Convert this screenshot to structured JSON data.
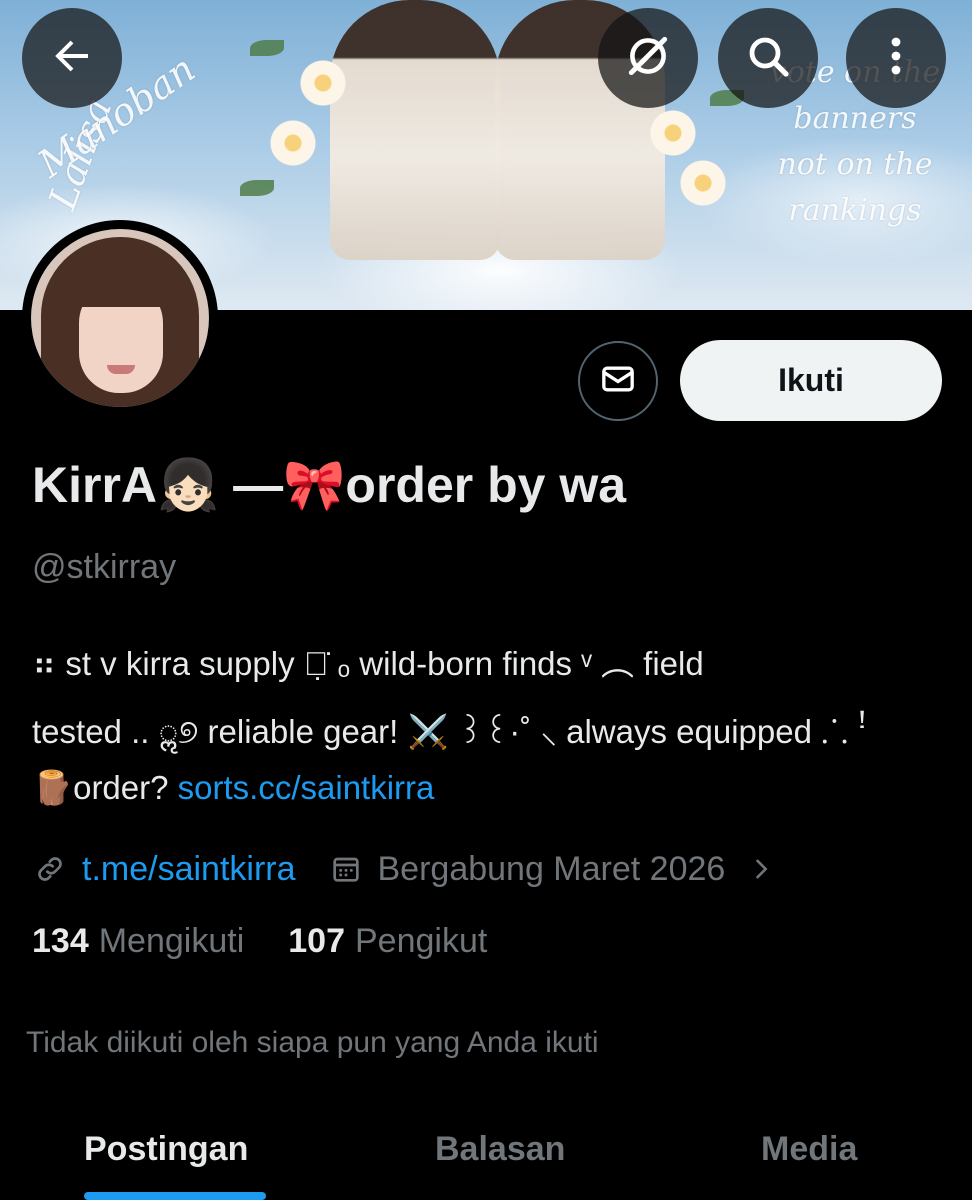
{
  "banner": {
    "left_script": [
      "Lalisa",
      "Manoban"
    ],
    "right_script": [
      "vote on the",
      "banners",
      "not on the",
      "rankings"
    ]
  },
  "top_bar": {
    "back_icon": "arrow-left-icon",
    "grok_icon": "grok-icon",
    "search_icon": "search-icon",
    "more_icon": "more-vertical-icon"
  },
  "profile": {
    "follow_label": "Ikuti",
    "message_icon": "envelope-icon",
    "display_name": "KirrA👧🏻 —🎀order by wa",
    "handle": "@stkirray",
    "bio": {
      "line1": "⠶ st v kirra supply ︵̣̇ ₒ wild-born finds ᵛ ︵ field",
      "line2": "tested .. ॢ୭ reliable gear! ⚔️ ꒱꒰·˚ ⸜ always equipped ⸫ ꜝ",
      "line3_prefix": "🪵order? ",
      "line3_link": "sorts.cc/saintkirra"
    },
    "website": "t.me/saintkirra",
    "joined": "Bergabung Maret 2026",
    "following_count": "134",
    "following_label": "Mengikuti",
    "followers_count": "107",
    "followers_label": "Pengikut",
    "followed_note": "Tidak diikuti oleh siapa pun yang Anda ikuti"
  },
  "tabs": [
    {
      "label": "Postingan",
      "active": true
    },
    {
      "label": "Balasan",
      "active": false
    },
    {
      "label": "Media",
      "active": false
    }
  ],
  "colors": {
    "background": "#000000",
    "text_primary": "#e7e9ea",
    "text_secondary": "#71767b",
    "link": "#1d9bf0",
    "accent": "#1d9bf0"
  }
}
